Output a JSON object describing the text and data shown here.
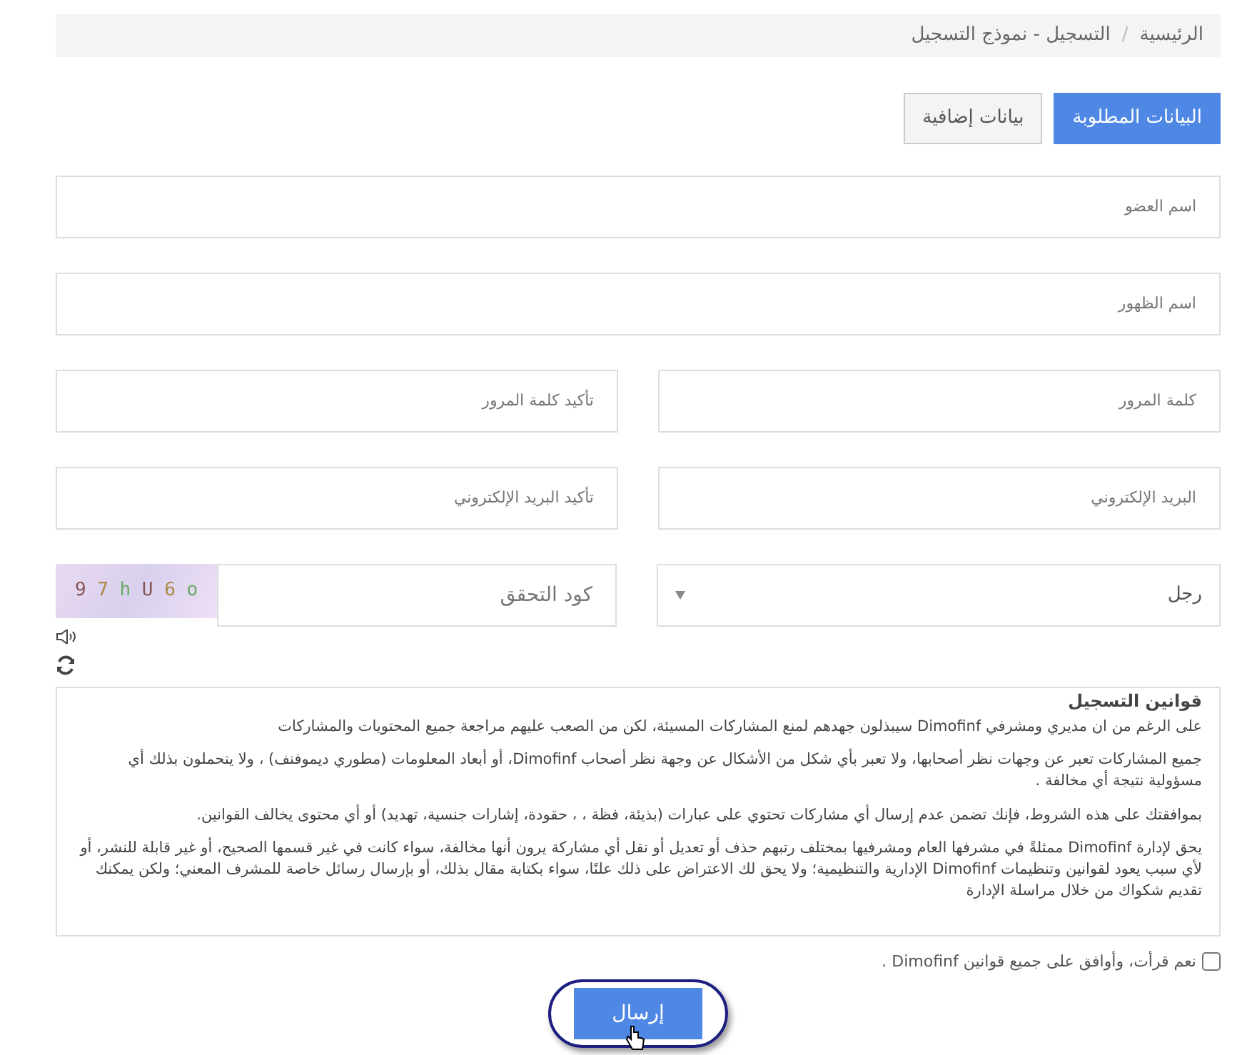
{
  "breadcrumb_separator": "/",
  "breadcrumb": [
    {
      "label": "الرئيسية"
    },
    {
      "label": "التسجيل - نموذج التسجيل"
    }
  ],
  "tabs": [
    {
      "label": "البيانات المطلوبة",
      "selected": true
    },
    {
      "label": "بيانات إضافية",
      "selected": false
    }
  ],
  "fields": [
    {
      "kind": "full",
      "placeholder": "اسم العضو"
    },
    {
      "kind": "full",
      "placeholder": "اسم الظهور"
    },
    {
      "kind": "pair",
      "items": [
        {
          "placeholder": "كلمة المرور"
        },
        {
          "placeholder": "تأكيد كلمة المرور"
        }
      ]
    },
    {
      "kind": "pair",
      "items": [
        {
          "placeholder": "البريد الإلكتروني"
        },
        {
          "placeholder": "تأكيد البريد الإلكتروني"
        }
      ]
    }
  ],
  "gender_select": {
    "value": "رجل"
  },
  "captcha": {
    "placeholder": "كود التحقق",
    "code": "9 7 h U 6 o"
  },
  "rules": {
    "title": "قوانين التسجيل",
    "paragraphs": [
      "على الرغم من ان مديري ومشرفي Dimofinf سيبذلون جهدهم لمنع المشاركات المسيئة، لكن من الصعب عليهم مراجعة جميع المحتويات والمشاركات",
      "جميع المشاركات تعبر عن وجهات نظر أصحابها، ولا تعبر بأي شكل من الأشكال عن وجهة نظر أصحاب Dimofinf، أو أبعاد المعلومات (مطوري ديموفنف) ، ولا يتحملون بذلك أي مسؤولية نتيجة أي مخالفة .",
      "بموافقتك على هذه الشروط، فإنك تضمن عدم إرسال أي مشاركات تحتوي على عبارات (بذيئة، فظة ، ، حقودة، إشارات جنسية، تهديد) أو أي محتوى يخالف القوانين.",
      "يحق لإدارة Dimofinf ممثلةً في مشرفها العام ومشرفيها بمختلف رتبهم حذف أو تعديل أو نقل أي مشاركة يرون أنها مخالفة، سواء كانت في غير قسمها الصحيح، أو غير قابلة للنشر، أو لأي سبب يعود لقوانين وتنظيمات Dimofinf الإدارية والتنظيمية؛ ولا يحق لك الاعتراض على ذلك علنًا، سواء بكتابة مقال بذلك، أو بإرسال رسائل خاصة للمشرف المعني؛ ولكن يمكنك تقديم شكواك من خلال مراسلة الإدارة"
    ]
  },
  "agree": {
    "label": "نعم قرأت، وأوافق على جميع قوانين Dimofinf .",
    "checked": false
  },
  "submit": {
    "label": "إرسال"
  }
}
